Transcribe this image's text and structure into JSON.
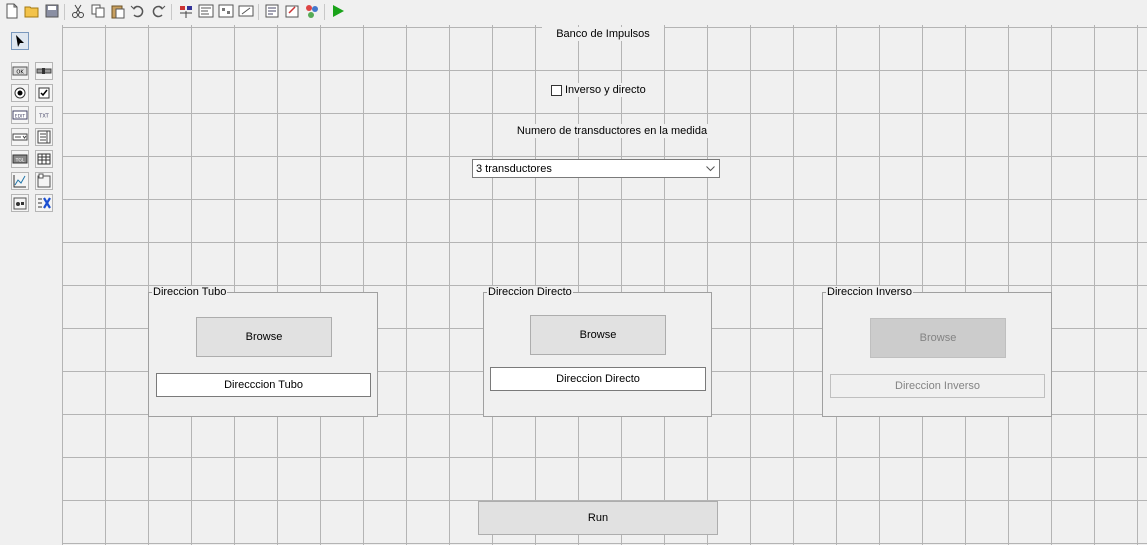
{
  "toolbar": {
    "icons": [
      "new-file-icon",
      "open-folder-icon",
      "save-icon",
      "cut-icon",
      "copy-icon",
      "paste-icon",
      "undo-icon",
      "redo-icon",
      "align-icon",
      "menu-editor-icon",
      "tab-order-icon",
      "toolbar-editor-icon",
      "editor-icon",
      "property-inspector-icon",
      "object-browser-icon",
      "run-figure-icon"
    ]
  },
  "palette": {
    "items": [
      "select-tool-icon",
      "push-button-tool-icon",
      "slider-tool-icon",
      "radio-button-tool-icon",
      "checkbox-tool-icon",
      "edit-text-tool-icon",
      "static-text-tool-icon",
      "popup-menu-tool-icon",
      "listbox-tool-icon",
      "toggle-button-tool-icon",
      "table-tool-icon",
      "axes-tool-icon",
      "panel-tool-icon",
      "button-group-tool-icon",
      "activex-tool-icon"
    ],
    "labels": {
      "push": "OK",
      "edit": "EDIT",
      "static": "TXT",
      "toggle": "TGL"
    }
  },
  "form": {
    "title": "Banco de Impulsos",
    "checkbox_label": "Inverso y directo",
    "transducer_label": "Numero de transductores en la medida",
    "transducer_selected": "3 transductores",
    "panels": [
      {
        "title": "Direccion Tubo",
        "browse": "Browse",
        "path": "Direcccion Tubo",
        "enabled": true
      },
      {
        "title": "Direccion Directo",
        "browse": "Browse",
        "path": "Direccion Directo",
        "enabled": true
      },
      {
        "title": "Direccion Inverso",
        "browse": "Browse",
        "path": "Direccion Inverso",
        "enabled": false
      }
    ],
    "run_label": "Run"
  },
  "colors": {
    "grid": "#b4b4b4",
    "background": "#f0f0f0",
    "run_icon": "#1aa31a"
  }
}
